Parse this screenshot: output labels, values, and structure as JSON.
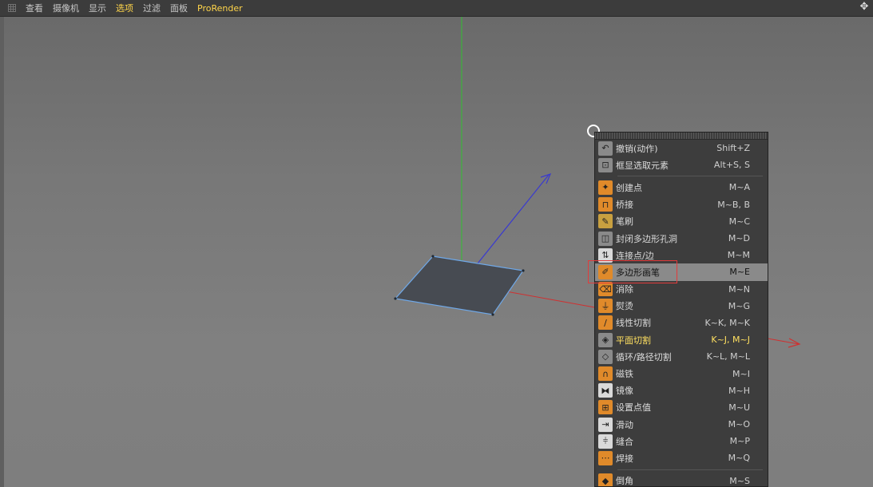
{
  "menubar": {
    "items": [
      {
        "label": "查看"
      },
      {
        "label": "摄像机"
      },
      {
        "label": "显示"
      },
      {
        "label": "选项",
        "active": true
      },
      {
        "label": "过滤"
      },
      {
        "label": "面板"
      },
      {
        "label": "ProRender",
        "accent": true
      }
    ]
  },
  "context_menu": {
    "items": [
      {
        "label": "撤销(动作)",
        "shortcut": "Shift+Z",
        "icon": "undo-icon",
        "icon_color": "#8a8a8a"
      },
      {
        "label": "框显选取元素",
        "shortcut": "Alt+S, S",
        "icon": "frame-selection-icon",
        "icon_color": "#8a8a8a"
      },
      {
        "separator": true
      },
      {
        "label": "创建点",
        "shortcut": "M~A",
        "icon": "create-point-icon",
        "icon_color": "#e08a2a"
      },
      {
        "label": "桥接",
        "shortcut": "M~B, B",
        "icon": "bridge-icon",
        "icon_color": "#e08a2a"
      },
      {
        "label": "笔刷",
        "shortcut": "M~C",
        "icon": "brush-icon",
        "icon_color": "#c8a040"
      },
      {
        "label": "封闭多边形孔洞",
        "shortcut": "M~D",
        "icon": "close-hole-icon",
        "icon_color": "#8a8a8a"
      },
      {
        "label": "连接点/边",
        "shortcut": "M~M",
        "icon": "connect-icon",
        "icon_color": "#d9d9d9"
      },
      {
        "label": "多边形画笔",
        "shortcut": "M~E",
        "icon": "polygon-pen-icon",
        "icon_color": "#e08a2a",
        "selected": true
      },
      {
        "label": "消除",
        "shortcut": "M~N",
        "icon": "dissolve-icon",
        "icon_color": "#e08a2a"
      },
      {
        "label": "熨烫",
        "shortcut": "M~G",
        "icon": "iron-icon",
        "icon_color": "#e08a2a"
      },
      {
        "label": "线性切割",
        "shortcut": "K~K, M~K",
        "icon": "knife-icon",
        "icon_color": "#e08a2a"
      },
      {
        "label": "平面切割",
        "shortcut": "K~J, M~J",
        "icon": "plane-cut-icon",
        "icon_color": "#8a8a8a",
        "highlight": true
      },
      {
        "label": "循环/路径切割",
        "shortcut": "K~L, M~L",
        "icon": "loop-cut-icon",
        "icon_color": "#8a8a8a"
      },
      {
        "label": "磁铁",
        "shortcut": "M~I",
        "icon": "magnet-icon",
        "icon_color": "#e08a2a"
      },
      {
        "label": "镜像",
        "shortcut": "M~H",
        "icon": "mirror-icon",
        "icon_color": "#d9d9d9"
      },
      {
        "label": "设置点值",
        "shortcut": "M~U",
        "icon": "set-value-icon",
        "icon_color": "#e08a2a"
      },
      {
        "label": "滑动",
        "shortcut": "M~O",
        "icon": "slide-icon",
        "icon_color": "#d9d9d9"
      },
      {
        "label": "缝合",
        "shortcut": "M~P",
        "icon": "stitch-icon",
        "icon_color": "#d9d9d9"
      },
      {
        "label": "焊接",
        "shortcut": "M~Q",
        "icon": "weld-icon",
        "icon_color": "#e08a2a"
      },
      {
        "separator": true
      },
      {
        "label": "倒角",
        "shortcut": "M~S",
        "icon": "bevel-icon",
        "icon_color": "#e08a2a"
      }
    ]
  },
  "colors": {
    "axis_x": "#d03030",
    "axis_y": "#30c030",
    "axis_z": "#3a3acf",
    "polygon_fill": "#474b52",
    "polygon_edge": "#6fa8e8",
    "highlight_box": "#e23b3b"
  }
}
